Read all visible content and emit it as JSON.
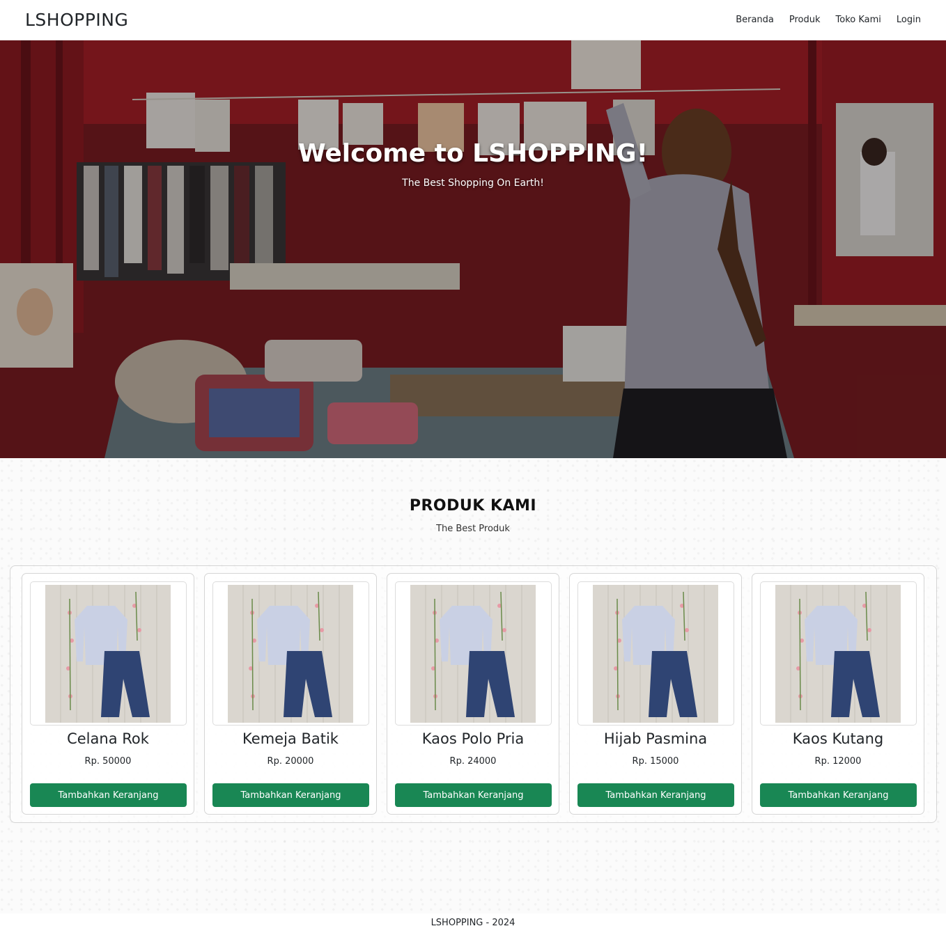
{
  "navbar": {
    "brand": "LSHOPPING",
    "links": [
      "Beranda",
      "Produk",
      "Toko Kami",
      "Login"
    ]
  },
  "hero": {
    "title": "Welcome to LSHOPPING!",
    "subtitle": "The Best Shopping On Earth!"
  },
  "section": {
    "title": "PRODUK KAMI",
    "subtitle": "The Best Produk"
  },
  "products": [
    {
      "name": "Celana Rok",
      "price": "Rp. 50000",
      "button": "Tambahkan Keranjang"
    },
    {
      "name": "Kemeja Batik",
      "price": "Rp. 20000",
      "button": "Tambahkan Keranjang"
    },
    {
      "name": "Kaos Polo Pria",
      "price": "Rp. 24000",
      "button": "Tambahkan Keranjang"
    },
    {
      "name": "Hijab Pasmina",
      "price": "Rp. 15000",
      "button": "Tambahkan Keranjang"
    },
    {
      "name": "Kaos Kutang",
      "price": "Rp. 12000",
      "button": "Tambahkan Keranjang"
    }
  ],
  "footer": {
    "text": "LSHOPPING - 2024"
  },
  "colors": {
    "button": "#198754",
    "hero_tent": "#b3202a"
  }
}
